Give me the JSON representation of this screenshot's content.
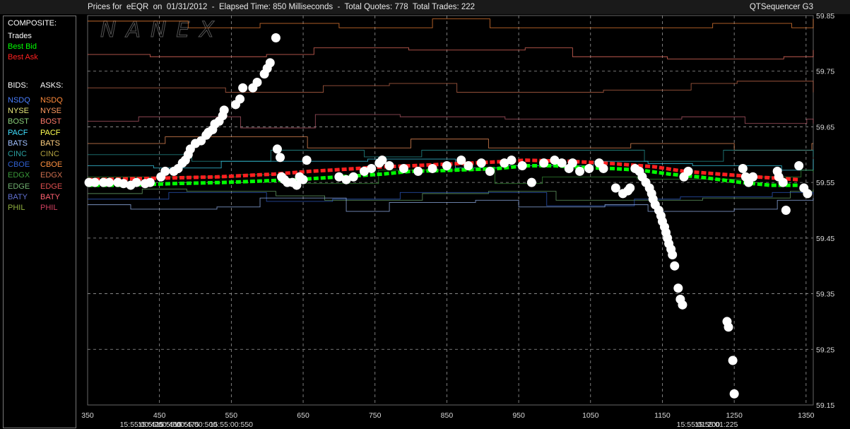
{
  "header": {
    "title": "Prices for  eEQR  on  01/31/2012  -  Elapsed Time: 850 Milliseconds  -  Total Quotes: 778  Total Trades: 222",
    "brand": "QTSequencer G3",
    "watermark": "NANEX"
  },
  "legend": {
    "composite_label": "COMPOSITE:",
    "composite": [
      {
        "label": "Trades",
        "color": "#ffffff"
      },
      {
        "label": "Best Bid",
        "color": "#00ff00"
      },
      {
        "label": "Best Ask",
        "color": "#ff2020"
      }
    ],
    "bids_label": "BIDS:",
    "asks_label": "ASKS:",
    "exchanges": [
      {
        "bid": "NSDQ",
        "ask": "NSDQ",
        "bid_color": "#4a7fff",
        "ask_color": "#ff8a3a"
      },
      {
        "bid": "NYSE",
        "ask": "NYSE",
        "bid_color": "#e8e87a",
        "ask_color": "#ff9a60"
      },
      {
        "bid": "BOST",
        "ask": "BOST",
        "bid_color": "#8ad07a",
        "ask_color": "#ff7a6a"
      },
      {
        "bid": "PACF",
        "ask": "PACF",
        "bid_color": "#40e0ff",
        "ask_color": "#ffff50"
      },
      {
        "bid": "BATS",
        "ask": "BATS",
        "bid_color": "#a0c0ff",
        "ask_color": "#ffd080"
      },
      {
        "bid": "CINC",
        "ask": "CINC",
        "bid_color": "#2aa0a0",
        "ask_color": "#b0a040"
      },
      {
        "bid": "CBOE",
        "ask": "CBOE",
        "bid_color": "#3060d0",
        "ask_color": "#ff9040"
      },
      {
        "bid": "EDGX",
        "ask": "EDGX",
        "bid_color": "#3a9a3a",
        "ask_color": "#d07050"
      },
      {
        "bid": "EDGE",
        "ask": "EDGE",
        "bid_color": "#70b070",
        "ask_color": "#e05050"
      },
      {
        "bid": "BATY",
        "ask": "BATY",
        "bid_color": "#6070d0",
        "ask_color": "#ff6070"
      },
      {
        "bid": "PHIL",
        "ask": "PHIL",
        "bid_color": "#90b040",
        "ask_color": "#d04060"
      }
    ]
  },
  "chart_data": {
    "type": "scatter",
    "title": "Prices for  eEQR  on  01/31/2012",
    "xlim": [
      350,
      1360
    ],
    "ylim": [
      59.15,
      59.85
    ],
    "y_ticks": [
      "59.85",
      "59.75",
      "59.65",
      "59.55",
      "59.45",
      "59.35",
      "59.25",
      "59.15"
    ],
    "x_ticks": [
      "350",
      "450",
      "550",
      "650",
      "750",
      "850",
      "950",
      "1050",
      "1150",
      "1250",
      "1350"
    ],
    "time_labels": [
      {
        "x": 425,
        "label": "15:55:00:425"
      },
      {
        "x": 450,
        "label": "15:55:00:450"
      },
      {
        "x": 475,
        "label": "15:55:00:475"
      },
      {
        "x": 500,
        "label": "15:55:00:500"
      },
      {
        "x": 550,
        "label": "15:55:00:550"
      },
      {
        "x": 1200,
        "label": "15:55:01:200"
      },
      {
        "x": 1225,
        "label": "15:55:01:225"
      }
    ],
    "grid": true,
    "colors": {
      "trades": "#ffffff",
      "best_bid": "#00ff00",
      "best_ask": "#ff2020",
      "grid": "#aaaaaa"
    },
    "best_bid": [
      [
        350,
        59.545
      ],
      [
        400,
        59.545
      ],
      [
        470,
        59.548
      ],
      [
        540,
        59.55
      ],
      [
        640,
        59.555
      ],
      [
        700,
        59.56
      ],
      [
        760,
        59.565
      ],
      [
        800,
        59.57
      ],
      [
        860,
        59.572
      ],
      [
        920,
        59.575
      ],
      [
        960,
        59.58
      ],
      [
        1000,
        59.58
      ],
      [
        1040,
        59.577
      ],
      [
        1080,
        59.575
      ],
      [
        1120,
        59.572
      ],
      [
        1160,
        59.565
      ],
      [
        1200,
        59.56
      ],
      [
        1260,
        59.55
      ],
      [
        1300,
        59.545
      ],
      [
        1340,
        59.545
      ]
    ],
    "best_ask": [
      [
        350,
        59.555
      ],
      [
        430,
        59.557
      ],
      [
        530,
        59.56
      ],
      [
        610,
        59.565
      ],
      [
        660,
        59.57
      ],
      [
        700,
        59.573
      ],
      [
        760,
        59.578
      ],
      [
        800,
        59.58
      ],
      [
        870,
        59.584
      ],
      [
        920,
        59.587
      ],
      [
        960,
        59.59
      ],
      [
        1020,
        59.588
      ],
      [
        1080,
        59.584
      ],
      [
        1140,
        59.578
      ],
      [
        1180,
        59.57
      ],
      [
        1230,
        59.565
      ],
      [
        1280,
        59.56
      ],
      [
        1340,
        59.555
      ]
    ],
    "trades": [
      [
        352,
        59.55
      ],
      [
        360,
        59.55
      ],
      [
        372,
        59.55
      ],
      [
        380,
        59.55
      ],
      [
        392,
        59.55
      ],
      [
        400,
        59.548
      ],
      [
        410,
        59.545
      ],
      [
        418,
        59.55
      ],
      [
        430,
        59.548
      ],
      [
        437,
        59.55
      ],
      [
        452,
        59.56
      ],
      [
        458,
        59.57
      ],
      [
        470,
        59.57
      ],
      [
        476,
        59.575
      ],
      [
        482,
        59.585
      ],
      [
        486,
        59.59
      ],
      [
        490,
        59.6
      ],
      [
        493,
        59.61
      ],
      [
        500,
        59.62
      ],
      [
        508,
        59.625
      ],
      [
        515,
        59.635
      ],
      [
        518,
        59.64
      ],
      [
        524,
        59.645
      ],
      [
        527,
        59.655
      ],
      [
        533,
        59.66
      ],
      [
        538,
        59.67
      ],
      [
        540,
        59.68
      ],
      [
        556,
        59.69
      ],
      [
        562,
        59.7
      ],
      [
        566,
        59.72
      ],
      [
        580,
        59.72
      ],
      [
        586,
        59.73
      ],
      [
        596,
        59.745
      ],
      [
        600,
        59.755
      ],
      [
        604,
        59.765
      ],
      [
        612,
        59.81
      ],
      [
        614,
        59.61
      ],
      [
        618,
        59.595
      ],
      [
        620,
        59.56
      ],
      [
        624,
        59.555
      ],
      [
        628,
        59.55
      ],
      [
        635,
        59.55
      ],
      [
        641,
        59.545
      ],
      [
        645,
        59.56
      ],
      [
        650,
        59.555
      ],
      [
        655,
        59.59
      ],
      [
        700,
        59.56
      ],
      [
        710,
        59.555
      ],
      [
        720,
        59.56
      ],
      [
        735,
        59.57
      ],
      [
        745,
        59.575
      ],
      [
        756,
        59.585
      ],
      [
        760,
        59.59
      ],
      [
        770,
        59.58
      ],
      [
        790,
        59.575
      ],
      [
        810,
        59.57
      ],
      [
        830,
        59.575
      ],
      [
        850,
        59.58
      ],
      [
        870,
        59.59
      ],
      [
        880,
        59.58
      ],
      [
        898,
        59.585
      ],
      [
        910,
        59.57
      ],
      [
        930,
        59.585
      ],
      [
        940,
        59.59
      ],
      [
        955,
        59.58
      ],
      [
        968,
        59.55
      ],
      [
        985,
        59.585
      ],
      [
        1000,
        59.59
      ],
      [
        1010,
        59.585
      ],
      [
        1020,
        59.575
      ],
      [
        1025,
        59.585
      ],
      [
        1035,
        59.57
      ],
      [
        1048,
        59.575
      ],
      [
        1062,
        59.585
      ],
      [
        1068,
        59.575
      ],
      [
        1085,
        59.54
      ],
      [
        1095,
        59.53
      ],
      [
        1102,
        59.535
      ],
      [
        1105,
        59.54
      ],
      [
        1112,
        59.575
      ],
      [
        1118,
        59.57
      ],
      [
        1122,
        59.56
      ],
      [
        1127,
        59.55
      ],
      [
        1132,
        59.54
      ],
      [
        1135,
        59.53
      ],
      [
        1137,
        59.52
      ],
      [
        1140,
        59.51
      ],
      [
        1145,
        59.5
      ],
      [
        1148,
        59.49
      ],
      [
        1150,
        59.48
      ],
      [
        1153,
        59.47
      ],
      [
        1155,
        59.46
      ],
      [
        1157,
        59.45
      ],
      [
        1159,
        59.44
      ],
      [
        1162,
        59.43
      ],
      [
        1164,
        59.42
      ],
      [
        1167,
        59.4
      ],
      [
        1172,
        59.36
      ],
      [
        1175,
        59.34
      ],
      [
        1178,
        59.33
      ],
      [
        1180,
        59.56
      ],
      [
        1186,
        59.57
      ],
      [
        1240,
        59.3
      ],
      [
        1242,
        59.29
      ],
      [
        1248,
        59.23
      ],
      [
        1250,
        59.17
      ],
      [
        1262,
        59.575
      ],
      [
        1266,
        59.56
      ],
      [
        1270,
        59.55
      ],
      [
        1276,
        59.56
      ],
      [
        1310,
        59.57
      ],
      [
        1312,
        59.56
      ],
      [
        1318,
        59.55
      ],
      [
        1322,
        59.5
      ],
      [
        1340,
        59.58
      ],
      [
        1347,
        59.54
      ],
      [
        1352,
        59.53
      ]
    ]
  }
}
